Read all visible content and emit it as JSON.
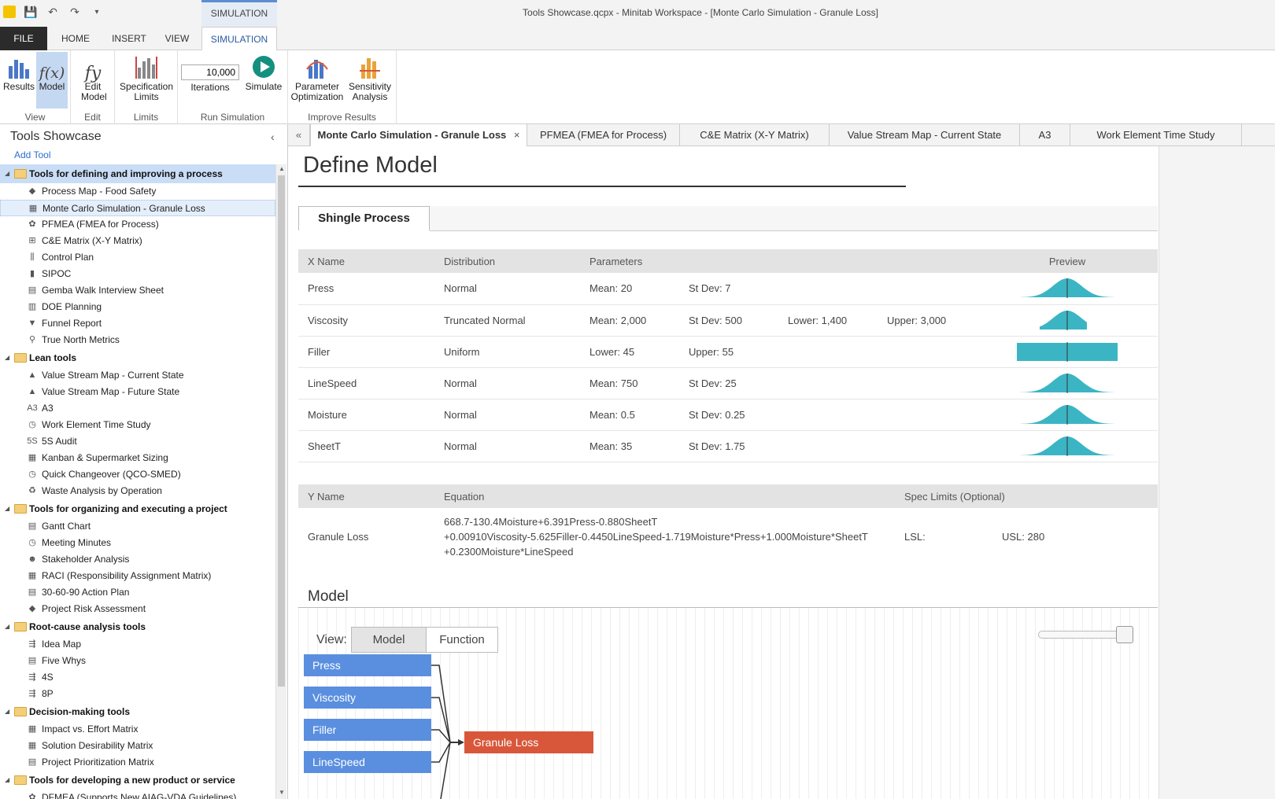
{
  "window": {
    "title": "Tools Showcase.qcpx - Minitab Workspace - [Monte Carlo Simulation - Granule Loss]",
    "context_tab_label": "SIMULATION"
  },
  "ribbon_tabs": [
    "FILE",
    "HOME",
    "INSERT",
    "VIEW",
    "SIMULATION"
  ],
  "ribbon": {
    "view_group": {
      "label": "View",
      "results": "Results",
      "model": "Model"
    },
    "edit_group": {
      "label": "Edit",
      "edit_model": "Edit Model"
    },
    "limits_group": {
      "label": "Limits",
      "spec_limits": "Specification Limits"
    },
    "run_group": {
      "label": "Run Simulation",
      "iterations_value": "10,000",
      "iterations_label": "Iterations",
      "simulate": "Simulate"
    },
    "improve_group": {
      "label": "Improve Results",
      "param_opt": "Parameter Optimization",
      "sensitivity": "Sensitivity Analysis"
    }
  },
  "sidebar": {
    "title": "Tools Showcase",
    "add_tool": "Add Tool",
    "groups": [
      {
        "label": "Tools for defining and improving a process",
        "items": [
          {
            "label": "Process Map - Food Safety",
            "icon": "◆"
          },
          {
            "label": "Monte Carlo Simulation - Granule Loss",
            "icon": "▦"
          },
          {
            "label": "PFMEA (FMEA for Process)",
            "icon": "✿"
          },
          {
            "label": "C&E Matrix (X-Y Matrix)",
            "icon": "⊞"
          },
          {
            "label": "Control Plan",
            "icon": "⫼"
          },
          {
            "label": "SIPOC",
            "icon": "▮"
          },
          {
            "label": "Gemba Walk Interview Sheet",
            "icon": "▤"
          },
          {
            "label": "DOE Planning",
            "icon": "▥"
          },
          {
            "label": "Funnel Report",
            "icon": "▼"
          },
          {
            "label": "True North Metrics",
            "icon": "⚲"
          }
        ]
      },
      {
        "label": "Lean tools",
        "items": [
          {
            "label": "Value Stream Map - Current State",
            "icon": "▲"
          },
          {
            "label": "Value Stream Map - Future State",
            "icon": "▲"
          },
          {
            "label": "A3",
            "icon": "A3"
          },
          {
            "label": "Work Element Time Study",
            "icon": "◷"
          },
          {
            "label": "5S Audit",
            "icon": "5S"
          },
          {
            "label": "Kanban & Supermarket Sizing",
            "icon": "▦"
          },
          {
            "label": "Quick Changeover (QCO-SMED)",
            "icon": "◷"
          },
          {
            "label": "Waste Analysis by Operation",
            "icon": "♻"
          }
        ]
      },
      {
        "label": "Tools for organizing and executing a project",
        "items": [
          {
            "label": "Gantt Chart",
            "icon": "▤"
          },
          {
            "label": "Meeting Minutes",
            "icon": "◷"
          },
          {
            "label": "Stakeholder Analysis",
            "icon": "☻"
          },
          {
            "label": "RACI (Responsibility Assignment Matrix)",
            "icon": "▦"
          },
          {
            "label": "30-60-90 Action Plan",
            "icon": "▤"
          },
          {
            "label": "Project Risk Assessment",
            "icon": "◆"
          }
        ]
      },
      {
        "label": "Root-cause analysis tools",
        "items": [
          {
            "label": "Idea Map",
            "icon": "⇶"
          },
          {
            "label": "Five Whys",
            "icon": "▤"
          },
          {
            "label": "4S",
            "icon": "⇶"
          },
          {
            "label": "8P",
            "icon": "⇶"
          }
        ]
      },
      {
        "label": "Decision-making tools",
        "items": [
          {
            "label": "Impact vs. Effort Matrix",
            "icon": "▦"
          },
          {
            "label": "Solution Desirability Matrix",
            "icon": "▦"
          },
          {
            "label": "Project Prioritization Matrix",
            "icon": "▤"
          }
        ]
      },
      {
        "label": "Tools for developing a new product or service",
        "items": [
          {
            "label": "DFMEA (Supports New AIAG-VDA Guidelines)",
            "icon": "✿"
          }
        ]
      }
    ]
  },
  "doc_tabs": [
    "Monte Carlo Simulation - Granule Loss",
    "PFMEA (FMEA for Process)",
    "C&E Matrix (X-Y Matrix)",
    "Value Stream Map - Current State",
    "A3",
    "Work Element Time Study"
  ],
  "main": {
    "title": "Define Model",
    "process_tab": "Shingle Process",
    "x_headers": {
      "name": "X Name",
      "distribution": "Distribution",
      "parameters": "Parameters",
      "preview": "Preview"
    },
    "x_rows": [
      {
        "name": "Press",
        "distribution": "Normal",
        "p1": "Mean: 20",
        "p2": "St Dev: 7",
        "p3": "",
        "p4": "",
        "preview": "normal"
      },
      {
        "name": "Viscosity",
        "distribution": "Truncated Normal",
        "p1": "Mean: 2,000",
        "p2": "St Dev: 500",
        "p3": "Lower: 1,400",
        "p4": "Upper: 3,000",
        "preview": "truncated"
      },
      {
        "name": "Filler",
        "distribution": "Uniform",
        "p1": "Lower: 45",
        "p2": "Upper: 55",
        "p3": "",
        "p4": "",
        "preview": "uniform"
      },
      {
        "name": "LineSpeed",
        "distribution": "Normal",
        "p1": "Mean: 750",
        "p2": "St Dev: 25",
        "p3": "",
        "p4": "",
        "preview": "normal"
      },
      {
        "name": "Moisture",
        "distribution": "Normal",
        "p1": "Mean: 0.5",
        "p2": "St Dev: 0.25",
        "p3": "",
        "p4": "",
        "preview": "normal"
      },
      {
        "name": "SheetT",
        "distribution": "Normal",
        "p1": "Mean: 35",
        "p2": "St Dev: 1.75",
        "p3": "",
        "p4": "",
        "preview": "normal"
      }
    ],
    "y_headers": {
      "name": "Y Name",
      "equation": "Equation",
      "spec": "Spec Limits (Optional)"
    },
    "y_row": {
      "name": "Granule Loss",
      "equation_l1": "668.7-130.4Moisture+6.391Press-0.880SheetT",
      "equation_l2": "+0.00910Viscosity-5.625Filler-0.4450LineSpeed-1.719Moisture*Press+1.000Moisture*SheetT",
      "equation_l3": "+0.2300Moisture*LineSpeed",
      "lsl": "LSL:",
      "usl": "USL: 280"
    },
    "model_heading": "Model",
    "view_label": "View:",
    "view_options": [
      "Model",
      "Function"
    ],
    "x_nodes": [
      "Press",
      "Viscosity",
      "Filler",
      "LineSpeed"
    ],
    "y_node": "Granule Loss",
    "colors": {
      "x_node": "#5a8fe0",
      "y_node": "#d8573a",
      "preview": "#3bb5c4"
    }
  }
}
